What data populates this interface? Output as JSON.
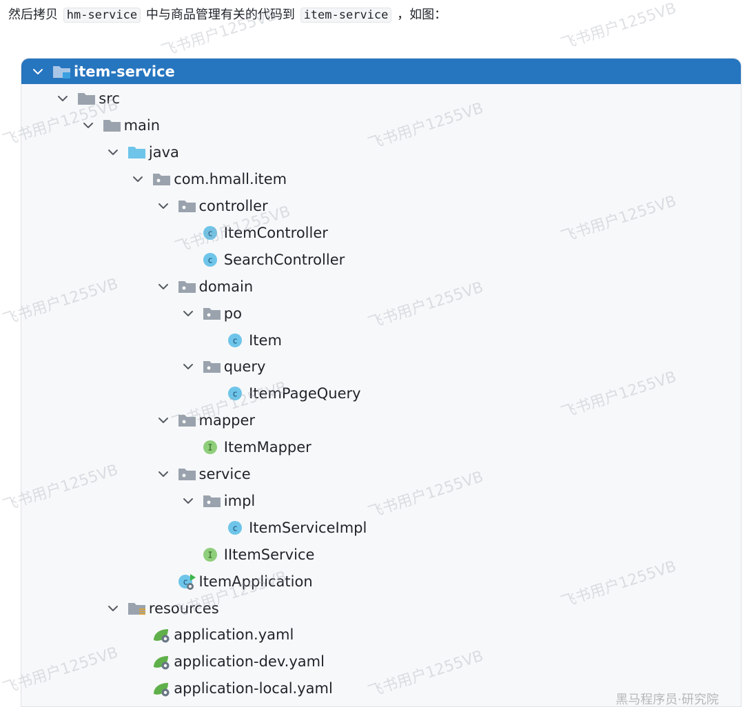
{
  "intro": {
    "before": "然后拷贝",
    "code1": "hm-service",
    "middle": "中与商品管理有关的代码到",
    "code2": "item-service",
    "after": "，如图："
  },
  "watermark": "飞书用户1255VB",
  "corner_mark": "黑马程序员·研究院",
  "colors": {
    "selected_bg": "#2675bf",
    "folder_gray": "#9aa3ad",
    "source_folder": "#6ec5e9",
    "class_circle": "#6ec5e9",
    "interface_circle": "#8fce7a",
    "spring_green": "#5fb04a"
  },
  "tree": [
    {
      "label": "item-service",
      "depth": 0,
      "icon": "module-folder-icon",
      "expanded": true,
      "selected": true
    },
    {
      "label": "src",
      "depth": 1,
      "icon": "folder-icon",
      "expanded": true
    },
    {
      "label": "main",
      "depth": 2,
      "icon": "folder-icon",
      "expanded": true
    },
    {
      "label": "java",
      "depth": 3,
      "icon": "source-folder-icon",
      "expanded": true
    },
    {
      "label": "com.hmall.item",
      "depth": 4,
      "icon": "package-icon",
      "expanded": true
    },
    {
      "label": "controller",
      "depth": 5,
      "icon": "package-icon",
      "expanded": true
    },
    {
      "label": "ItemController",
      "depth": 6,
      "icon": "class-icon"
    },
    {
      "label": "SearchController",
      "depth": 6,
      "icon": "class-icon"
    },
    {
      "label": "domain",
      "depth": 5,
      "icon": "package-icon",
      "expanded": true
    },
    {
      "label": "po",
      "depth": 6,
      "icon": "package-icon",
      "expanded": true
    },
    {
      "label": "Item",
      "depth": 7,
      "icon": "class-icon"
    },
    {
      "label": "query",
      "depth": 6,
      "icon": "package-icon",
      "expanded": true
    },
    {
      "label": "ItemPageQuery",
      "depth": 7,
      "icon": "class-icon"
    },
    {
      "label": "mapper",
      "depth": 5,
      "icon": "package-icon",
      "expanded": true
    },
    {
      "label": "ItemMapper",
      "depth": 6,
      "icon": "interface-icon"
    },
    {
      "label": "service",
      "depth": 5,
      "icon": "package-icon",
      "expanded": true
    },
    {
      "label": "impl",
      "depth": 6,
      "icon": "package-icon",
      "expanded": true
    },
    {
      "label": "ItemServiceImpl",
      "depth": 7,
      "icon": "class-icon"
    },
    {
      "label": "IItemService",
      "depth": 6,
      "icon": "interface-icon"
    },
    {
      "label": "ItemApplication",
      "depth": 5,
      "icon": "spring-boot-class-icon"
    },
    {
      "label": "resources",
      "depth": 3,
      "icon": "resources-folder-icon",
      "expanded": true
    },
    {
      "label": "application.yaml",
      "depth": 4,
      "icon": "spring-yaml-icon"
    },
    {
      "label": "application-dev.yaml",
      "depth": 4,
      "icon": "spring-yaml-icon"
    },
    {
      "label": "application-local.yaml",
      "depth": 4,
      "icon": "spring-yaml-icon"
    }
  ]
}
